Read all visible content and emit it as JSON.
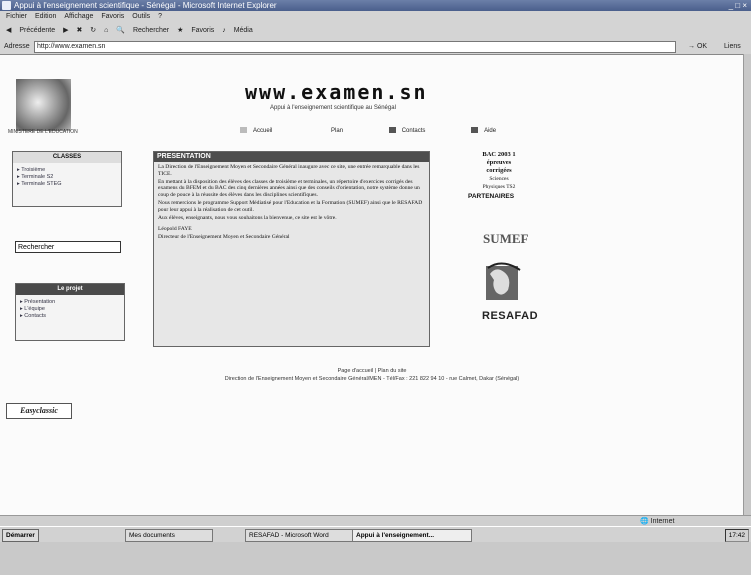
{
  "window": {
    "title": "Appui à l'enseignement scientifique - Sénégal - Microsoft Internet Explorer",
    "controls": "_ □ ×"
  },
  "menu": [
    "Fichier",
    "Edition",
    "Affichage",
    "Favoris",
    "Outils",
    "?"
  ],
  "toolbar": {
    "back": "Précédente",
    "search": "Rechercher",
    "favorites": "Favoris",
    "media": "Média"
  },
  "address": {
    "label": "Adresse",
    "url": "http://www.examen.sn",
    "go": "OK",
    "links": "Liens"
  },
  "site": {
    "logo_caption": "MINISTERE DE L'EDUCATION",
    "title": "www.examen.sn",
    "subtitle": "Appui à l'enseignement scientifique au Sénégal",
    "nav": [
      "Accueil",
      "Plan",
      "Contacts",
      "Aide"
    ]
  },
  "classes": {
    "header": "CLASSES",
    "items": [
      "Troisième",
      "Terminale S2",
      "Terminale STEG"
    ]
  },
  "search": {
    "value": "Rechercher"
  },
  "projet": {
    "header": "Le projet",
    "items": [
      "Présentation",
      "L'équipe",
      "Contacts"
    ]
  },
  "presentation": {
    "header": "PRESENTATION",
    "paragraphs": [
      "La Direction de l'Enseignement Moyen et Secondaire Général inaugure avec ce site, une entrée remarquable dans les TICE.",
      "En mettant à la disposition des élèves des classes de troisième et terminales, un répertoire d'exercices corrigés des examens du BFEM et du BAC des cinq dernières années ainsi que des conseils d'orientation, notre système donne un coup de pouce à la réussite des élèves dans les disciplines scientifiques.",
      "Nous remercions le programme Support Médiatisé pour l'Education et la Formation (SUMEF) ainsi que le RESAFAD pour leur appui à la réalisation de cet outil.",
      "Aux élèves, enseignants, nous vous souhaitons la bienvenue, ce site est le vôtre."
    ],
    "signature_name": "Léopold FAYE",
    "signature_title": "Directeur de l'Enseignement Moyen et Secondaire Général"
  },
  "bac": {
    "line1": "BAC 2003 1",
    "line2": "épreuves",
    "line3": "corrigées",
    "line4": "Sciences",
    "line5": "Physiques TS2"
  },
  "partners": {
    "header": "PARTENAIRES",
    "sumef": "SUMEF",
    "resafad": "RESAFAD"
  },
  "footer": {
    "line1": "Page d'accueil | Plan du site",
    "line2": "Direction de l'Enseignement Moyen et Secondaire Général/MEN - Tél/Fax : 221 822 94 10 - rue Calmet, Dakar (Sénégal)"
  },
  "badge": "Easyclassic",
  "status": {
    "zone": "Internet"
  },
  "taskbar": {
    "start": "Démarrer",
    "tasks": [
      "Mes documents",
      "RESAFAD - Microsoft Word",
      "Appui à l'enseignement..."
    ],
    "clock": "17:42"
  }
}
